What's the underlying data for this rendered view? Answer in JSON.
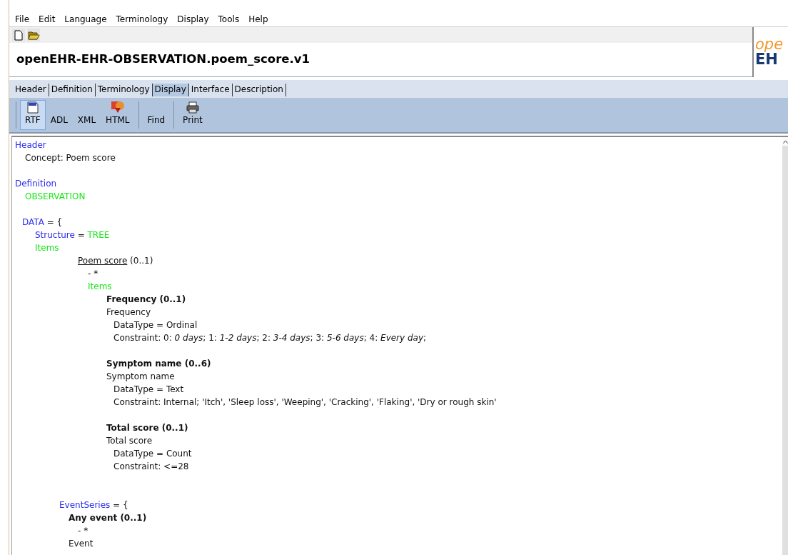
{
  "menu": [
    "File",
    "Edit",
    "Language",
    "Terminology",
    "Display",
    "Tools",
    "Help"
  ],
  "file_title": "openEHR-EHR-OBSERVATION.poem_score.v1",
  "logo": {
    "top": "ope",
    "bottom": "EH"
  },
  "tabs": [
    {
      "label": "Header",
      "selected": false
    },
    {
      "label": "Definition",
      "selected": false
    },
    {
      "label": "Terminology",
      "selected": false
    },
    {
      "label": "Display",
      "selected": true
    },
    {
      "label": "Interface",
      "selected": false
    },
    {
      "label": "Description",
      "selected": false
    }
  ],
  "view_buttons": [
    {
      "label": "RTF",
      "kind": "document",
      "selected": true
    },
    {
      "label": "ADL",
      "kind": "plain",
      "selected": false
    },
    {
      "label": "XML",
      "kind": "plain",
      "selected": false
    },
    {
      "label": "HTML",
      "kind": "browser",
      "selected": false
    },
    {
      "label": "Find",
      "kind": "plain",
      "selected": false
    },
    {
      "label": "Print",
      "kind": "printer",
      "selected": false
    }
  ],
  "document_lines": [
    {
      "kind": "section",
      "segments": [
        {
          "text": "Header",
          "kind": "keyword"
        }
      ]
    },
    {
      "kind": "concept",
      "segments": [
        {
          "text": "Concept: Poem score",
          "kind": "text"
        }
      ]
    },
    {
      "kind": "gap"
    },
    {
      "kind": "section",
      "segments": [
        {
          "text": "Definition",
          "kind": "keyword"
        }
      ]
    },
    {
      "kind": "concept",
      "segments": [
        {
          "text": "OBSERVATION",
          "kind": "type"
        }
      ]
    },
    {
      "kind": "gap"
    },
    {
      "kind": "data",
      "segments": [
        {
          "text": "DATA",
          "kind": "keyword"
        },
        {
          "text": " = {",
          "kind": "text"
        }
      ]
    },
    {
      "kind": "structure",
      "segments": [
        {
          "text": "Structure",
          "kind": "keyword"
        },
        {
          "text": " = ",
          "kind": "text"
        },
        {
          "text": "TREE",
          "kind": "type"
        }
      ]
    },
    {
      "kind": "structure",
      "segments": [
        {
          "text": "Items",
          "kind": "type"
        }
      ]
    },
    {
      "kind": "node",
      "segments": [
        {
          "text": "Poem score",
          "kind": "link"
        },
        {
          "text": " (0..1)",
          "kind": "text"
        }
      ]
    },
    {
      "kind": "occurrence",
      "segments": [
        {
          "text": "- *",
          "kind": "text"
        }
      ]
    },
    {
      "kind": "occurrence",
      "segments": [
        {
          "text": "Items",
          "kind": "type"
        }
      ]
    },
    {
      "kind": "element",
      "segments": [
        {
          "text": "Frequency (0..1)",
          "kind": "bold"
        }
      ]
    },
    {
      "kind": "element",
      "segments": [
        {
          "text": "Frequency",
          "kind": "text"
        }
      ]
    },
    {
      "kind": "constraint",
      "segments": [
        {
          "text": "DataType = Ordinal",
          "kind": "text"
        }
      ]
    },
    {
      "kind": "constraint",
      "segments": [
        {
          "text": "Constraint: 0: ",
          "kind": "text"
        },
        {
          "text": "0 days",
          "kind": "italic"
        },
        {
          "text": "; 1: ",
          "kind": "text"
        },
        {
          "text": "1-2 days",
          "kind": "italic"
        },
        {
          "text": "; 2: ",
          "kind": "text"
        },
        {
          "text": "3-4 days",
          "kind": "italic"
        },
        {
          "text": "; 3: ",
          "kind": "text"
        },
        {
          "text": "5-6 days",
          "kind": "italic"
        },
        {
          "text": "; 4: ",
          "kind": "text"
        },
        {
          "text": "Every day",
          "kind": "italic"
        },
        {
          "text": ";",
          "kind": "text"
        }
      ]
    },
    {
      "kind": "gap"
    },
    {
      "kind": "element",
      "segments": [
        {
          "text": "Symptom name (0..6)",
          "kind": "bold"
        }
      ]
    },
    {
      "kind": "element",
      "segments": [
        {
          "text": "Symptom name",
          "kind": "text"
        }
      ]
    },
    {
      "kind": "constraint",
      "segments": [
        {
          "text": "DataType = Text",
          "kind": "text"
        }
      ]
    },
    {
      "kind": "constraint",
      "segments": [
        {
          "text": "Constraint: Internal; 'Itch', 'Sleep loss', 'Weeping', 'Cracking', 'Flaking', 'Dry or rough skin'",
          "kind": "text"
        }
      ]
    },
    {
      "kind": "gap"
    },
    {
      "kind": "element",
      "segments": [
        {
          "text": "Total score (0..1)",
          "kind": "bold"
        }
      ]
    },
    {
      "kind": "element",
      "segments": [
        {
          "text": "Total score",
          "kind": "text"
        }
      ]
    },
    {
      "kind": "constraint",
      "segments": [
        {
          "text": "DataType = Count",
          "kind": "text"
        }
      ]
    },
    {
      "kind": "constraint",
      "segments": [
        {
          "text": "Constraint: <=28",
          "kind": "text"
        }
      ]
    },
    {
      "kind": "gap"
    },
    {
      "kind": "gap"
    },
    {
      "kind": "series",
      "segments": [
        {
          "text": "EventSeries",
          "kind": "keyword"
        },
        {
          "text": " = {",
          "kind": "text"
        }
      ]
    },
    {
      "kind": "event",
      "segments": [
        {
          "text": "Any event (0..1)",
          "kind": "bold"
        }
      ]
    },
    {
      "kind": "event-occurrence",
      "segments": [
        {
          "text": "- *",
          "kind": "text"
        }
      ]
    },
    {
      "kind": "event",
      "segments": [
        {
          "text": "Event",
          "kind": "text"
        }
      ]
    }
  ]
}
